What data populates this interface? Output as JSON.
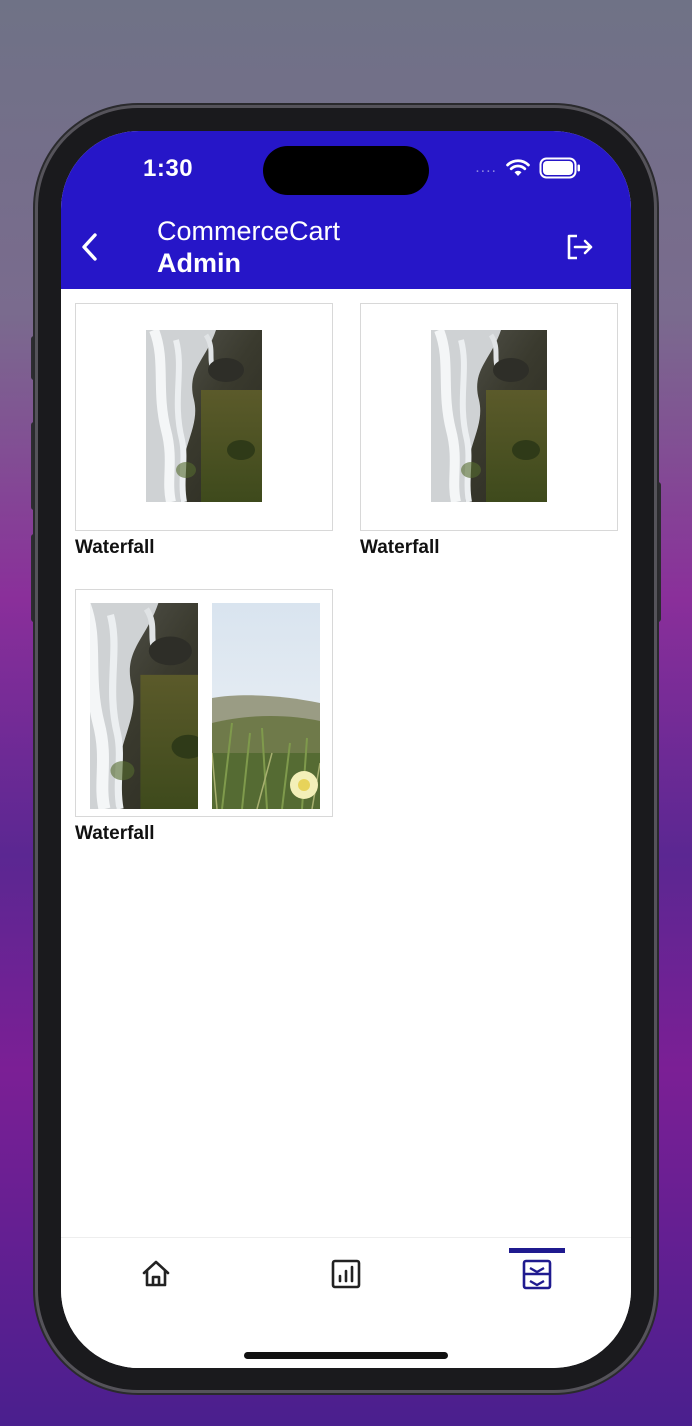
{
  "status_bar": {
    "time": "1:30",
    "signal_dots": "....",
    "wifi_icon": "wifi-icon",
    "battery_icon": "battery-icon"
  },
  "header": {
    "app_name": "CommerceCart",
    "subtitle": "Admin",
    "back_icon": "chevron-left-icon",
    "logout_icon": "logout-icon",
    "background_color": "#2616c8"
  },
  "products": [
    {
      "name": "Waterfall",
      "images": [
        "waterfall"
      ]
    },
    {
      "name": "Waterfall",
      "images": [
        "waterfall"
      ]
    },
    {
      "name": "Waterfall",
      "images": [
        "waterfall",
        "flower-grass"
      ]
    }
  ],
  "tab_bar": {
    "tabs": [
      {
        "icon": "home-icon",
        "active": false
      },
      {
        "icon": "chart-icon",
        "active": false
      },
      {
        "icon": "inventory-icon",
        "active": true
      }
    ],
    "accent_color": "#1f1a8f"
  }
}
